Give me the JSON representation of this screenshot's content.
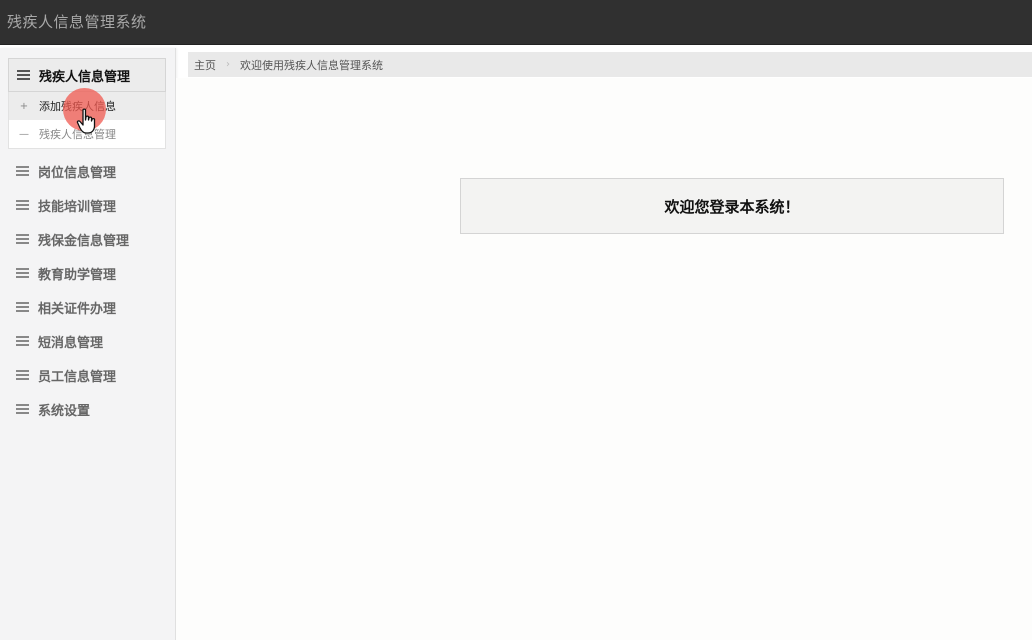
{
  "app": {
    "title": "残疾人信息管理系统"
  },
  "sidebar": {
    "active_group": {
      "label": "残疾人信息管理",
      "items": [
        {
          "prefix": "+",
          "label": "添加残疾人信息"
        },
        {
          "prefix": "—",
          "label": "残疾人信息管理"
        }
      ]
    },
    "groups": [
      {
        "label": "岗位信息管理"
      },
      {
        "label": "技能培训管理"
      },
      {
        "label": "残保金信息管理"
      },
      {
        "label": "教育助学管理"
      },
      {
        "label": "相关证件办理"
      },
      {
        "label": "短消息管理"
      },
      {
        "label": "员工信息管理"
      },
      {
        "label": "系统设置"
      }
    ]
  },
  "breadcrumb": {
    "home": "主页",
    "separator": "›",
    "current": "欢迎使用残疾人信息管理系统"
  },
  "main": {
    "welcome_text": "欢迎您登录本系统！"
  },
  "colors": {
    "topbar": "#303030",
    "sidebar": "#f4f4f5",
    "cursor_highlight": "#f05a50"
  },
  "icons": {
    "menu": "hamburger-icon",
    "cursor": "hand-pointer-icon"
  }
}
